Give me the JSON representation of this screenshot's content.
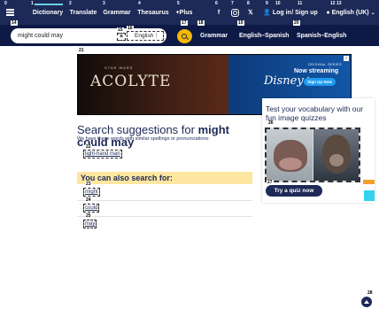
{
  "nav": {
    "items": [
      {
        "num": "0",
        "label": ""
      },
      {
        "num": "1",
        "label": "Dictionary"
      },
      {
        "num": "2",
        "label": "Translate"
      },
      {
        "num": "3",
        "label": "Grammar"
      },
      {
        "num": "4",
        "label": "Thesaurus"
      },
      {
        "num": "5",
        "label": "+Plus"
      },
      {
        "num": "6",
        "label": "f"
      },
      {
        "num": "7",
        "label": ""
      },
      {
        "num": "8",
        "label": "𝕏"
      },
      {
        "num": "9",
        "label": "Log in"
      },
      {
        "num": "10",
        "label": ""
      },
      {
        "num": "11",
        "label": "/ Sign up"
      },
      {
        "num": "12",
        "label": "English (UK)"
      },
      {
        "num": "13",
        "label": ""
      }
    ]
  },
  "search": {
    "num": "14",
    "value": "might could may",
    "placeholder": "Search English",
    "clear_num": "15",
    "clear_label": "×",
    "dict_num": "16",
    "dict_label": "English",
    "dict_dots": "⋮",
    "button_num": "17"
  },
  "searchbar_links": [
    {
      "num": "18",
      "label": "Grammar"
    },
    {
      "num": "19",
      "label": "English–Spanish"
    },
    {
      "num": "20",
      "label": "Spanish–English"
    }
  ],
  "ad": {
    "num": "21",
    "brand_small": "STAR WARS",
    "show": "ACOLYTE",
    "service": "Disney+",
    "tag_small": "ORIGINAL SERIES",
    "streaming": "Now streaming",
    "cta": "Sign Up Now"
  },
  "main": {
    "title_prefix": "Search suggestions for",
    "title_query": "might could may",
    "similar_text": "We have these words with similar spellings or pronunciations:",
    "similar_suggestion": {
      "num": "22",
      "label": "light-hand man"
    },
    "also_title": "You can also search for:",
    "also_items": [
      {
        "num": "23",
        "label": "might"
      },
      {
        "num": "24",
        "label": "could"
      },
      {
        "num": "25",
        "label": "may"
      }
    ]
  },
  "quiz": {
    "title": "Test your vocabulary with our fun image quizzes",
    "image_num": "26",
    "button_num": "27",
    "button_label": "Try a quiz now"
  },
  "scroll_top_num": "28",
  "colors": {
    "navy": "#1d2a57",
    "accent_yellow": "#f5b800",
    "accent_cyan": "#34d2ee",
    "highlight": "#fde7a0"
  }
}
